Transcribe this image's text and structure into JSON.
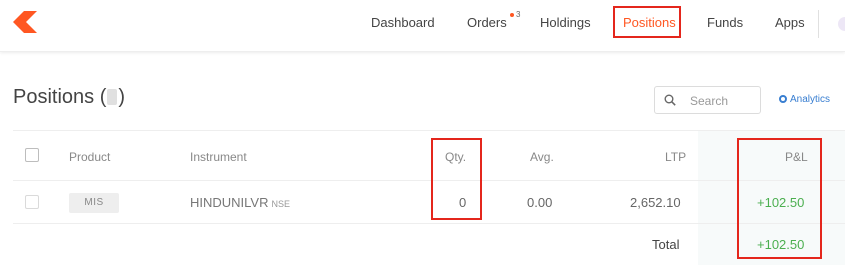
{
  "nav": {
    "items": [
      {
        "label": "Dashboard"
      },
      {
        "label": "Orders",
        "badge": "3"
      },
      {
        "label": "Holdings"
      },
      {
        "label": "Positions"
      },
      {
        "label": "Funds"
      },
      {
        "label": "Apps"
      }
    ],
    "active": "Positions",
    "accent_color": "#ff5722"
  },
  "header": {
    "title_prefix": "Positions (",
    "title_suffix": ")",
    "search_placeholder": "Search",
    "analytics_label": "Analytics"
  },
  "table": {
    "columns": [
      "Product",
      "Instrument",
      "Qty.",
      "Avg.",
      "LTP",
      "P&L"
    ],
    "rows": [
      {
        "product": "MIS",
        "instrument": "HINDUNILVR",
        "exchange": "NSE",
        "qty": "0",
        "avg": "0.00",
        "ltp": "2,652.10",
        "pnl": "+102.50"
      }
    ],
    "total_label": "Total",
    "total_pnl": "+102.50"
  },
  "colors": {
    "profit": "#4caf50",
    "link": "#387ed1",
    "highlight_box": "#e4261c"
  },
  "icons": [
    "kite-logo-icon",
    "search-icon",
    "analytics-icon"
  ]
}
